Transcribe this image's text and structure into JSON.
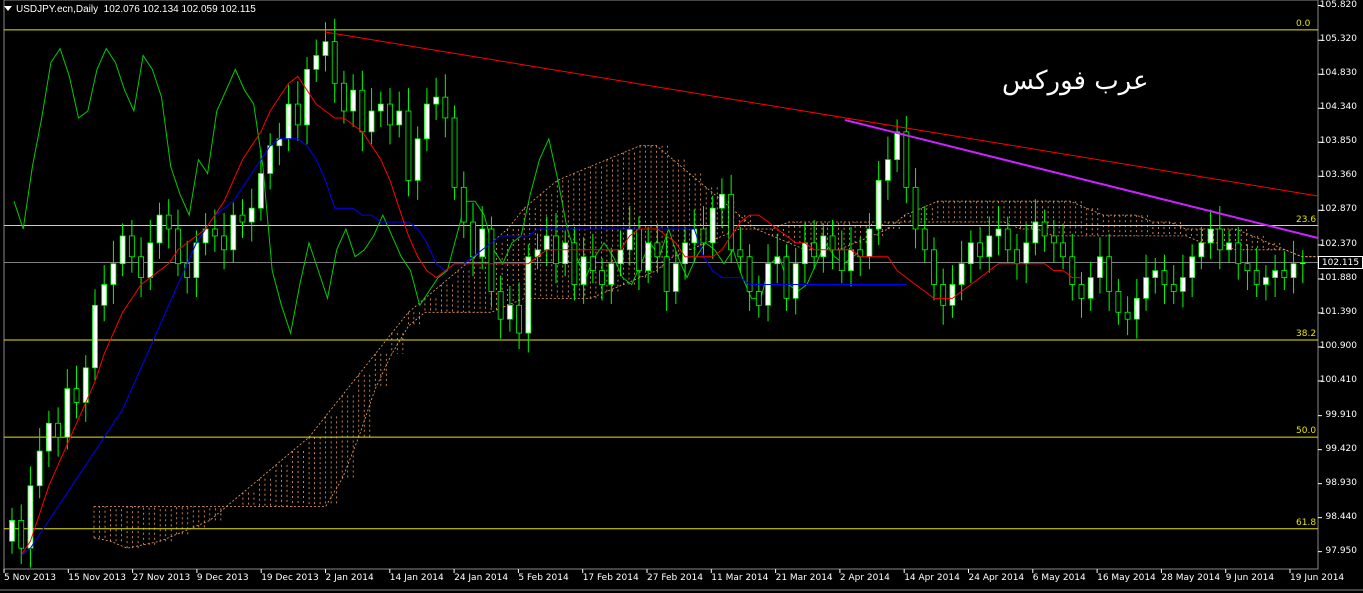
{
  "header": {
    "symbol": "USDJPY.ecn,Daily",
    "ohlc": "102.076 102.134 102.059 102.115"
  },
  "watermark": "عرب فوركس",
  "current_price": "102.115",
  "colors": {
    "background": "#000000",
    "bull": "#ffffff",
    "bear": "#000000",
    "candle_outline": "#00ff00",
    "tenkan": "#ff0000",
    "kijun": "#0000ff",
    "chikou": "#00cc00",
    "kumo": "#f0a060",
    "fibo": "#e6e600",
    "trendline_red": "#ff0000",
    "trendline_purple": "#cc22ff"
  },
  "chart_data": {
    "type": "candlestick",
    "title": "USDJPY.ecn,Daily",
    "yticks": [
      "105.820",
      "105.320",
      "104.830",
      "104.340",
      "103.850",
      "103.360",
      "102.870",
      "102.370",
      "101.880",
      "101.390",
      "100.900",
      "100.410",
      "99.910",
      "99.420",
      "98.930",
      "98.440",
      "97.950"
    ],
    "xticks": [
      "5 Nov 2013",
      "15 Nov 2013",
      "27 Nov 2013",
      "9 Dec 2013",
      "19 Dec 2013",
      "2 Jan 2014",
      "14 Jan 2014",
      "24 Jan 2014",
      "5 Feb 2014",
      "17 Feb 2014",
      "27 Feb 2014",
      "11 Mar 2014",
      "21 Mar 2014",
      "2 Apr 2014",
      "14 Apr 2014",
      "24 Apr 2014",
      "6 May 2014",
      "16 May 2014",
      "28 May 2014",
      "9 Jun 2014",
      "19 Jun 2014"
    ],
    "ylim": [
      97.7,
      105.9
    ],
    "fibonacci": [
      {
        "label": "0.0",
        "price": 105.47
      },
      {
        "label": "23.6",
        "price": 102.65
      },
      {
        "label": "38.2",
        "price": 101.0
      },
      {
        "label": "50.0",
        "price": 99.6
      },
      {
        "label": "61.8",
        "price": 98.28
      }
    ],
    "closes": [
      98.4,
      98.0,
      98.9,
      99.4,
      99.8,
      99.6,
      100.3,
      100.1,
      100.6,
      101.5,
      101.8,
      102.1,
      102.5,
      102.2,
      101.9,
      102.4,
      102.8,
      102.6,
      102.1,
      101.9,
      102.4,
      102.6,
      102.5,
      102.3,
      102.8,
      102.7,
      102.9,
      103.4,
      103.8,
      103.9,
      104.4,
      104.1,
      104.9,
      105.1,
      105.3,
      104.7,
      104.3,
      104.6,
      104.0,
      104.3,
      104.4,
      104.1,
      104.3,
      103.3,
      103.9,
      104.4,
      104.5,
      104.2,
      103.2,
      102.7,
      102.2,
      102.6,
      101.7,
      101.3,
      101.5,
      101.1,
      102.2,
      102.3,
      102.5,
      102.1,
      102.4,
      101.8,
      102.2,
      102.0,
      101.8,
      102.1,
      102.3,
      102.6,
      102.0,
      102.4,
      102.2,
      101.7,
      102.1,
      102.4,
      102.6,
      102.4,
      102.9,
      103.1,
      102.3,
      102.2,
      101.7,
      101.5,
      102.1,
      102.2,
      101.6,
      102.1,
      102.4,
      102.2,
      102.5,
      102.3,
      102.0,
      102.3,
      102.2,
      102.6,
      103.3,
      103.6,
      104.0,
      103.2,
      102.6,
      102.3,
      101.8,
      101.5,
      101.8,
      102.1,
      102.4,
      102.2,
      102.5,
      102.6,
      102.3,
      102.1,
      102.4,
      102.7,
      102.5,
      102.4,
      102.2,
      101.8,
      101.6,
      101.9,
      102.2,
      101.7,
      101.4,
      101.3,
      101.6,
      101.9,
      102.0,
      101.8,
      101.7,
      101.9,
      102.2,
      102.4,
      102.6,
      102.3,
      102.4,
      102.1,
      102.0,
      101.8,
      101.9,
      102.0,
      101.9,
      102.1,
      102.115
    ],
    "tenkan": [
      97.9,
      98.1,
      98.5,
      98.9,
      99.2,
      99.5,
      99.8,
      100.1,
      100.4,
      100.8,
      101.1,
      101.4,
      101.6,
      101.8,
      101.9,
      102.0,
      102.1,
      102.3,
      102.4,
      102.5,
      102.6,
      102.8,
      103.0,
      103.3,
      103.6,
      103.8,
      104.0,
      104.3,
      104.5,
      104.7,
      104.8,
      104.6,
      104.4,
      104.3,
      104.2,
      104.2,
      104.1,
      104.0,
      103.8,
      103.6,
      103.3,
      102.9,
      102.5,
      102.2,
      102.0,
      101.9,
      102.0,
      102.1,
      102.1,
      102.1,
      102.1,
      102.1,
      102.1,
      102.1,
      102.1,
      102.1,
      102.2,
      102.3,
      102.3,
      102.3,
      102.3,
      102.3,
      102.3,
      102.3,
      102.3,
      102.3,
      102.5,
      102.6,
      102.6,
      102.6,
      102.5,
      102.4,
      102.2,
      102.2,
      102.2,
      102.2,
      102.3,
      102.5,
      102.7,
      102.8,
      102.8,
      102.7,
      102.6,
      102.5,
      102.4,
      102.4,
      102.3,
      102.3,
      102.3,
      102.3,
      102.3,
      102.2,
      102.2,
      102.2,
      102.2,
      102.0,
      101.9,
      101.8,
      101.7,
      101.6,
      101.6,
      101.6,
      101.7,
      101.8,
      101.9,
      102.0,
      102.1,
      102.1,
      102.1,
      102.1,
      102.1,
      102.1,
      102.0,
      102.0,
      101.9,
      101.9
    ],
    "kijun": [
      97.9,
      98.0,
      98.2,
      98.4,
      98.6,
      98.8,
      99.0,
      99.2,
      99.4,
      99.6,
      99.8,
      100.0,
      100.3,
      100.6,
      100.9,
      101.2,
      101.5,
      101.8,
      102.1,
      102.4,
      102.6,
      102.8,
      102.9,
      103.0,
      103.2,
      103.4,
      103.6,
      103.8,
      103.9,
      103.9,
      103.9,
      103.8,
      103.6,
      103.3,
      102.9,
      102.9,
      102.9,
      102.8,
      102.8,
      102.7,
      102.7,
      102.7,
      102.7,
      102.6,
      102.4,
      102.1,
      102.0,
      102.1,
      102.1,
      102.2,
      102.3,
      102.4,
      102.5,
      102.5,
      102.5,
      102.5,
      102.6,
      102.6,
      102.6,
      102.6,
      102.6,
      102.6,
      102.6,
      102.6,
      102.6,
      102.6,
      102.6,
      102.6,
      102.6,
      102.6,
      102.6,
      102.6,
      102.6,
      102.6,
      102.2,
      102.0,
      101.9,
      101.9,
      101.9,
      101.8,
      101.8,
      101.8,
      101.8,
      101.8,
      101.8,
      101.8,
      101.8,
      101.8,
      101.8,
      101.8,
      101.8,
      101.8,
      101.8,
      101.8,
      101.8,
      101.8,
      101.8
    ],
    "chikou": [
      103.0,
      102.6,
      103.5,
      104.2,
      105.0,
      105.2,
      104.8,
      104.2,
      104.3,
      104.9,
      105.2,
      105.0,
      104.6,
      104.3,
      105.1,
      104.9,
      104.5,
      103.5,
      103.1,
      102.8,
      103.6,
      103.4,
      104.3,
      104.6,
      104.9,
      104.6,
      104.4,
      103.5,
      102.0,
      101.5,
      101.1,
      101.8,
      102.4,
      102.0,
      101.6,
      102.3,
      102.6,
      102.2,
      102.3,
      102.5,
      102.8,
      102.5,
      102.2,
      102.0,
      101.5,
      101.7,
      101.9,
      102.0,
      102.5,
      103.0,
      103.0,
      102.8,
      102.3,
      102.1,
      102.4,
      102.5,
      103.1,
      103.6,
      103.9,
      103.3,
      102.6,
      102.2,
      101.9,
      102.2,
      102.4,
      102.2,
      101.9,
      101.8,
      102.1,
      102.4,
      102.2,
      102.6,
      102.2,
      101.9,
      102.2,
      102.4,
      102.3,
      102.1,
      102.3,
      101.9,
      101.6,
      101.6,
      102.1,
      102.2,
      101.8,
      101.7,
      101.8,
      102.1,
      102.4,
      102.2,
      102.1,
      102.2,
      102.3
    ],
    "senkou_a": [
      98.15,
      98.1,
      98.0,
      98.05,
      98.1,
      98.2,
      98.3,
      98.4,
      98.6,
      98.8,
      99.0,
      99.2,
      99.4,
      99.6,
      99.9,
      100.2,
      100.5,
      100.8,
      101.1,
      101.4,
      101.6,
      101.8,
      102.0,
      102.2,
      102.4,
      102.6,
      102.9,
      103.1,
      103.3,
      103.4,
      103.5,
      103.6,
      103.7,
      103.8,
      103.8,
      103.6,
      103.4,
      103.2,
      103.0,
      102.8,
      102.6,
      102.5,
      102.4,
      102.3,
      102.3,
      102.3,
      102.4,
      102.5,
      102.6,
      102.8,
      102.9,
      103.0,
      103.0,
      103.0,
      103.0,
      103.0,
      103.0,
      103.0,
      103.0,
      103.0,
      102.9,
      102.8,
      102.8,
      102.8,
      102.7,
      102.7,
      102.6,
      102.6,
      102.6,
      102.6,
      102.5,
      102.4,
      102.3,
      102.2,
      102.2,
      102.1,
      102.1
    ],
    "senkou_b": [
      98.6,
      98.6,
      98.6,
      98.6,
      98.6,
      98.6,
      98.6,
      98.6,
      98.6,
      98.6,
      98.6,
      98.6,
      98.6,
      98.6,
      98.6,
      99.0,
      99.6,
      100.3,
      100.8,
      101.2,
      101.4,
      101.4,
      101.4,
      101.4,
      101.4,
      101.5,
      101.6,
      101.6,
      101.6,
      101.6,
      101.6,
      101.7,
      101.8,
      101.9,
      102.0,
      102.2,
      102.3,
      102.4,
      102.5,
      102.6,
      102.6,
      102.6,
      102.7,
      102.7,
      102.7,
      102.7,
      102.7,
      102.7,
      102.7,
      102.7,
      102.7,
      102.7,
      102.7,
      102.7,
      102.7,
      102.7,
      102.6,
      102.6,
      102.5,
      102.5,
      102.5,
      102.5,
      102.5,
      102.5,
      102.5,
      102.5,
      102.5,
      102.4,
      102.4,
      102.3,
      102.3,
      102.3,
      102.3,
      102.2,
      102.2,
      102.1,
      102.1
    ]
  }
}
